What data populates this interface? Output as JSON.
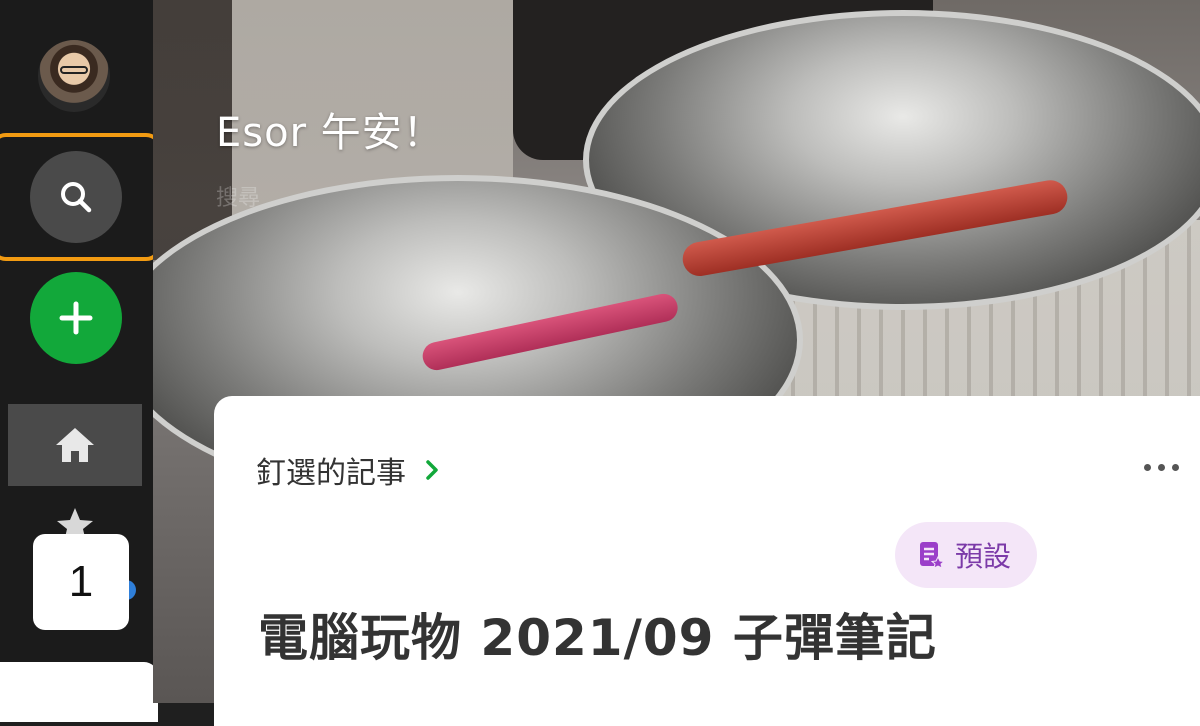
{
  "sidebar": {
    "avatar_alt": "user avatar",
    "search_icon": "search-icon",
    "new_icon": "plus-icon",
    "home_icon": "home-icon",
    "shortcuts_icon": "star-icon",
    "step_badge": "1",
    "highlight_color": "#f29b12",
    "new_button_color": "#12a83a"
  },
  "hero": {
    "greeting": "Esor 午安！",
    "ghost_label": "搜尋"
  },
  "pinned_note": {
    "section_label": "釘選的記事",
    "section_chevron": "chevron-right-icon",
    "more_icon": "more-horizontal-icon",
    "notebook_icon": "notebook-icon",
    "notebook_label": "預設",
    "title": "電腦玩物 2021/09 子彈筆記"
  }
}
